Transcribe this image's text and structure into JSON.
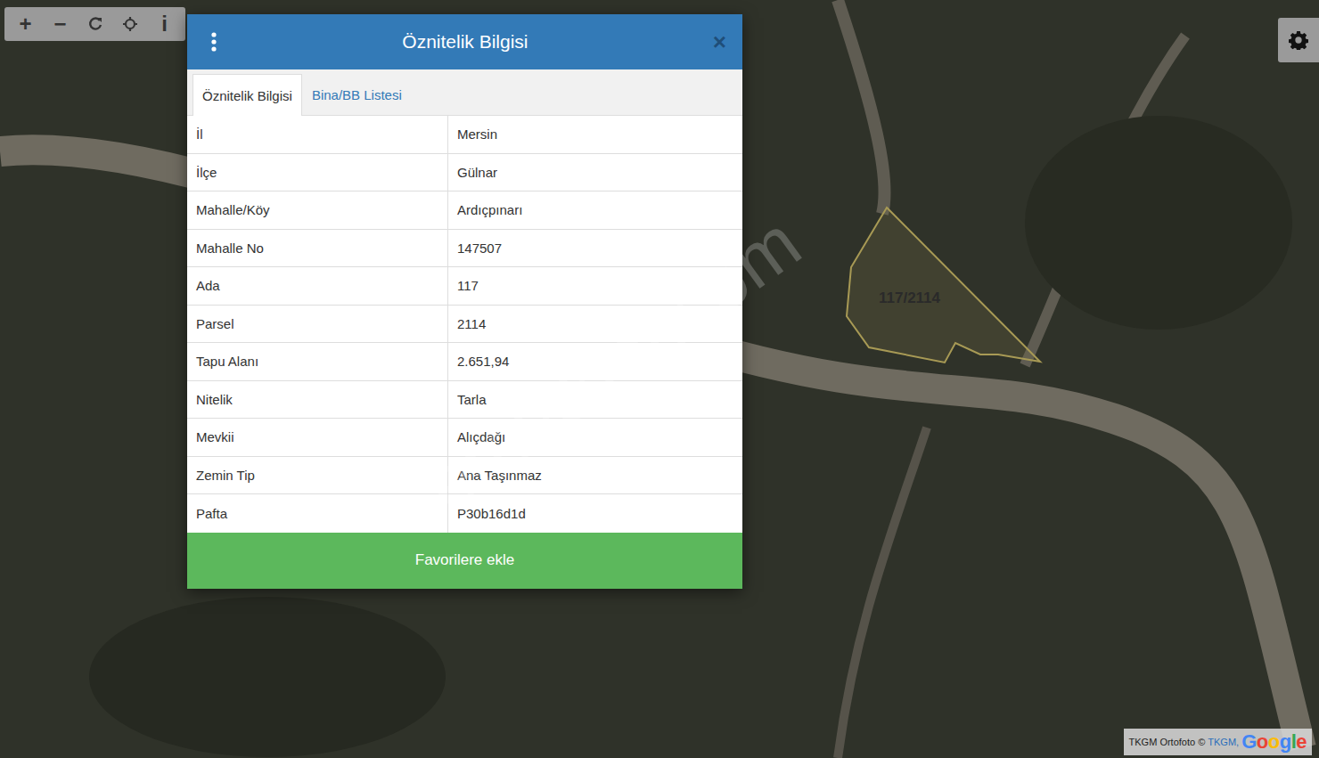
{
  "toolbar": [
    {
      "kind": "glyph",
      "label": "+"
    },
    {
      "kind": "glyph",
      "label": "−"
    },
    {
      "kind": "refresh"
    },
    {
      "kind": "locate"
    },
    {
      "kind": "glyph",
      "label": "i"
    }
  ],
  "dialog": {
    "title": "Öznitelik Bilgisi",
    "close": "×",
    "tabs": [
      {
        "label": "Öznitelik Bilgisi",
        "selected": true
      },
      {
        "label": "Bina/BB Listesi",
        "selected": false
      }
    ],
    "rows": [
      {
        "label": "İl",
        "value": "Mersin"
      },
      {
        "label": "İlçe",
        "value": "Gülnar"
      },
      {
        "label": "Mahalle/Köy",
        "value": "Ardıçpınarı"
      },
      {
        "label": "Mahalle No",
        "value": "147507"
      },
      {
        "label": "Ada",
        "value": "117"
      },
      {
        "label": "Parsel",
        "value": "2114"
      },
      {
        "label": "Tapu Alanı",
        "value": "2.651,94"
      },
      {
        "label": "Nitelik",
        "value": "Tarla"
      },
      {
        "label": "Mevkii",
        "value": "Alıçdağı"
      },
      {
        "label": "Zemin Tip",
        "value": "Ana Taşınmaz"
      },
      {
        "label": "Pafta",
        "value": "P30b16d1d"
      }
    ],
    "button": "Favorilere ekle"
  },
  "map": {
    "parcel_label": "117/2114",
    "watermark": "emlakjet.com",
    "attribution": {
      "prefix": "TKGM Ortofoto ©",
      "link": "TKGM,",
      "logo": "Google"
    }
  }
}
